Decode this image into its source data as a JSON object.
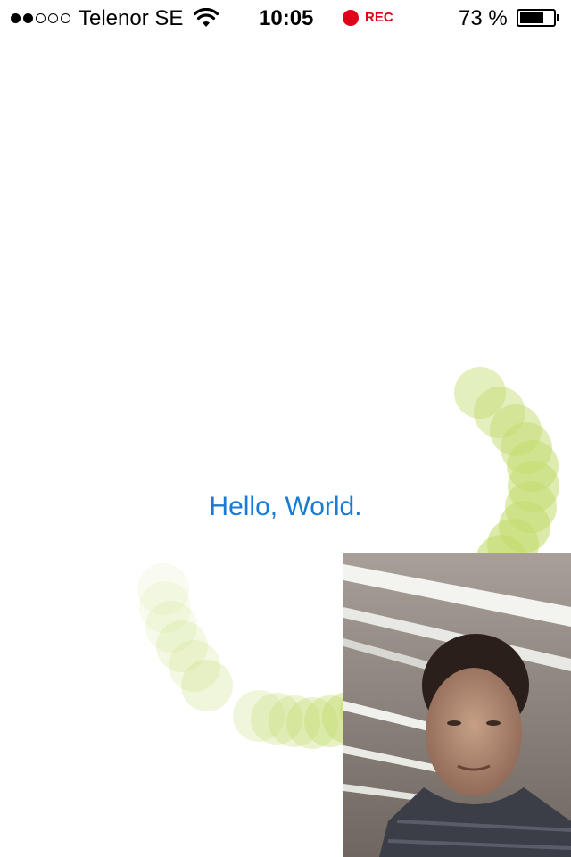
{
  "status_bar": {
    "signal_strength": 2,
    "signal_max": 5,
    "carrier": "Telenor SE",
    "wifi_icon": "wifi-icon",
    "time": "10:05",
    "recording_indicator": "REC",
    "recording_color": "#e0001a",
    "battery_percent_text": "73 %",
    "battery_level": 0.73
  },
  "main": {
    "greeting": "Hello, World.",
    "greeting_color": "#1a7ad4",
    "trail_color": "#c3dc6f"
  },
  "camera_preview": {
    "description_icon": "front-camera-preview"
  }
}
